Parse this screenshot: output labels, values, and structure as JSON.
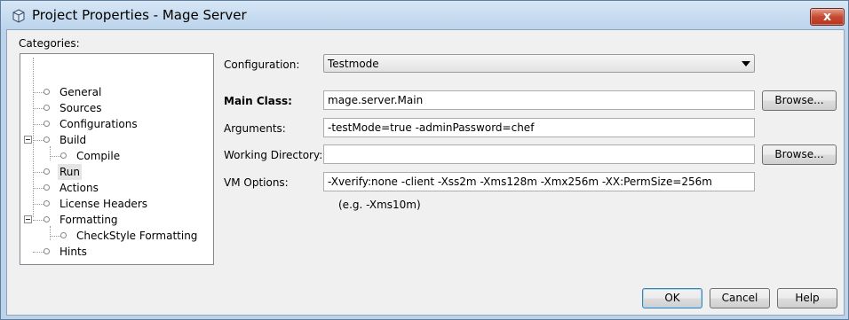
{
  "window": {
    "title": "Project Properties - Mage Server",
    "close_glyph": "x"
  },
  "categories": {
    "label": "Categories:",
    "items": [
      {
        "label": "General"
      },
      {
        "label": "Sources"
      },
      {
        "label": "Configurations"
      },
      {
        "label": "Build"
      },
      {
        "label": "Compile"
      },
      {
        "label": "Run",
        "selected": true
      },
      {
        "label": "Actions"
      },
      {
        "label": "License Headers"
      },
      {
        "label": "Formatting"
      },
      {
        "label": "CheckStyle Formatting"
      },
      {
        "label": "Hints"
      }
    ]
  },
  "form": {
    "configuration_label": "Configuration:",
    "configuration_value": "Testmode",
    "main_class_label": "Main Class:",
    "main_class_value": "mage.server.Main",
    "arguments_label": "Arguments:",
    "arguments_value": "-testMode=true -adminPassword=chef",
    "working_dir_label": "Working Directory:",
    "working_dir_value": "",
    "vm_options_label": "VM Options:",
    "vm_options_value": "-Xverify:none -client -Xss2m -Xms128m -Xmx256m -XX:PermSize=256m",
    "vm_options_hint": "(e.g. -Xms10m)",
    "browse_label": "Browse..."
  },
  "footer": {
    "ok_label": "OK",
    "cancel_label": "Cancel",
    "help_label": "Help"
  },
  "icons": {
    "title": "project-cube-icon",
    "close": "close-icon",
    "combo": "chevron-down-icon"
  }
}
